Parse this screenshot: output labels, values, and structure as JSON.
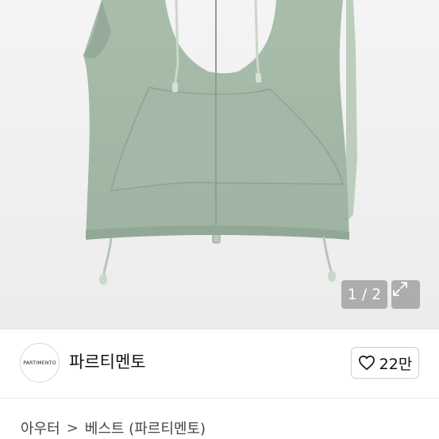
{
  "gallery": {
    "counter": "1 / 2",
    "expand_icon": "expand-arrows-icon"
  },
  "shop": {
    "logo_text": "PARTIMENTO",
    "name": "파르티멘토",
    "like_icon": "heart-outline-icon",
    "like_count": "22만"
  },
  "breadcrumb": {
    "level1": "아우터",
    "separator": ">",
    "level2": "베스트 (파르티멘토)"
  }
}
